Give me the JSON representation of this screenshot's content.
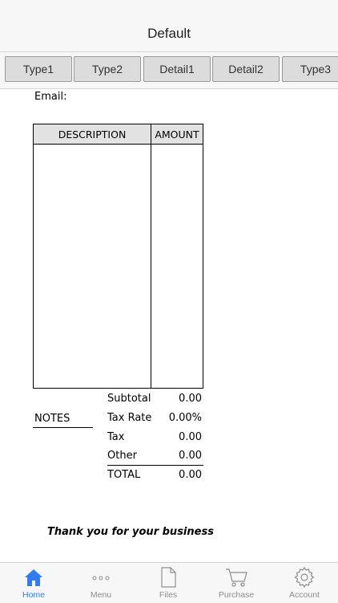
{
  "nav": {
    "title": "Default"
  },
  "segments": [
    "Type1",
    "Type2",
    "Detail1",
    "Detail2",
    "Type3"
  ],
  "document": {
    "email_label": "Email:",
    "table": {
      "desc_header": "DESCRIPTION",
      "amount_header": "AMOUNT"
    },
    "notes_label": "NOTES",
    "totals": [
      {
        "label": "Subtotal",
        "value": "0.00"
      },
      {
        "label": "Tax Rate",
        "value": "0.00%"
      },
      {
        "label": "Tax",
        "value": "0.00"
      },
      {
        "label": "Other",
        "value": "0.00"
      },
      {
        "label": "TOTAL",
        "value": "0.00"
      }
    ],
    "thanks": "Thank you for your business"
  },
  "tabs": [
    {
      "label": "Home",
      "icon": "home-icon",
      "active": true
    },
    {
      "label": "Menu",
      "icon": "more-icon",
      "active": false
    },
    {
      "label": "Files",
      "icon": "file-icon",
      "active": false
    },
    {
      "label": "Purchase",
      "icon": "cart-icon",
      "active": false
    },
    {
      "label": "Account",
      "icon": "gear-icon",
      "active": false
    }
  ],
  "colors": {
    "accent": "#2f7cf6",
    "inactive": "#8e8e8e"
  }
}
